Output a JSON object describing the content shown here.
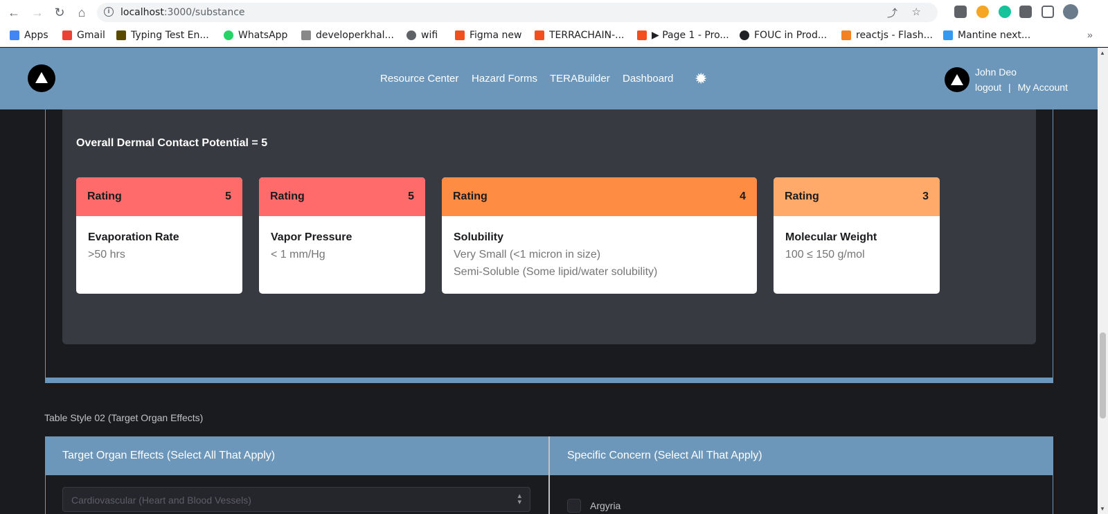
{
  "browser": {
    "url_host": "localhost",
    "url_path": ":3000/substance",
    "bookmarks": [
      {
        "label": "Apps",
        "icon": "apps-grid-icon",
        "color": "#4285f4"
      },
      {
        "label": "Gmail",
        "icon": "gmail-icon",
        "color": "#ea4335"
      },
      {
        "label": "Typing Test En...",
        "icon": "typing-test-icon",
        "color": "#5a4a00"
      },
      {
        "label": "WhatsApp",
        "icon": "whatsapp-icon",
        "color": "#25d366"
      },
      {
        "label": "developerkhal...",
        "icon": "dev-site-icon",
        "color": "#888888"
      },
      {
        "label": "wifi",
        "icon": "globe-icon",
        "color": "#5f6368"
      },
      {
        "label": "Figma new",
        "icon": "figma-icon",
        "color": "#f24e1e"
      },
      {
        "label": "TERRACHAIN-...",
        "icon": "figma-icon",
        "color": "#f24e1e"
      },
      {
        "label": "▶ Page 1 - Pro...",
        "icon": "figma-icon",
        "color": "#f24e1e"
      },
      {
        "label": "FOUC in Prod...",
        "icon": "github-icon",
        "color": "#202124"
      },
      {
        "label": "reactjs - Flash...",
        "icon": "stackoverflow-icon",
        "color": "#f48024"
      },
      {
        "label": "Mantine next...",
        "icon": "mantine-icon",
        "color": "#339af0"
      }
    ]
  },
  "header": {
    "nav": [
      "Resource Center",
      "Hazard Forms",
      "TERABuilder",
      "Dashboard"
    ],
    "user_name": "John Deo",
    "logout_label": "logout",
    "separator": "|",
    "account_label": "My Account"
  },
  "dermal": {
    "overall": "Overall Dermal Contact Potential = 5",
    "cards": [
      {
        "rating_label": "Rating",
        "rating": "5",
        "title": "Evaporation Rate",
        "lines": [
          ">50 hrs"
        ],
        "color": "#ff6b6b"
      },
      {
        "rating_label": "Rating",
        "rating": "5",
        "title": "Vapor Pressure",
        "lines": [
          "< 1 mm/Hg"
        ],
        "color": "#ff6b6b"
      },
      {
        "rating_label": "Rating",
        "rating": "4",
        "title": "Solubility",
        "lines": [
          "Very Small (<1 micron in size)",
          "Semi-Soluble (Some lipid/water solubility)"
        ],
        "color": "#ff8c42"
      },
      {
        "rating_label": "Rating",
        "rating": "3",
        "title": "Molecular Weight",
        "lines": [
          "100 ≤ 150 g/mol"
        ],
        "color": "#ffa96b"
      }
    ]
  },
  "table2": {
    "section_label": "Table Style 02 (Target Organ Effects)",
    "left_header": "Target Organ Effects (Select All That Apply)",
    "right_header": "Specific Concern (Select All That Apply)",
    "select_value": "Cardiovascular (Heart and Blood Vessels)",
    "checkbox_label": "Argyria"
  }
}
